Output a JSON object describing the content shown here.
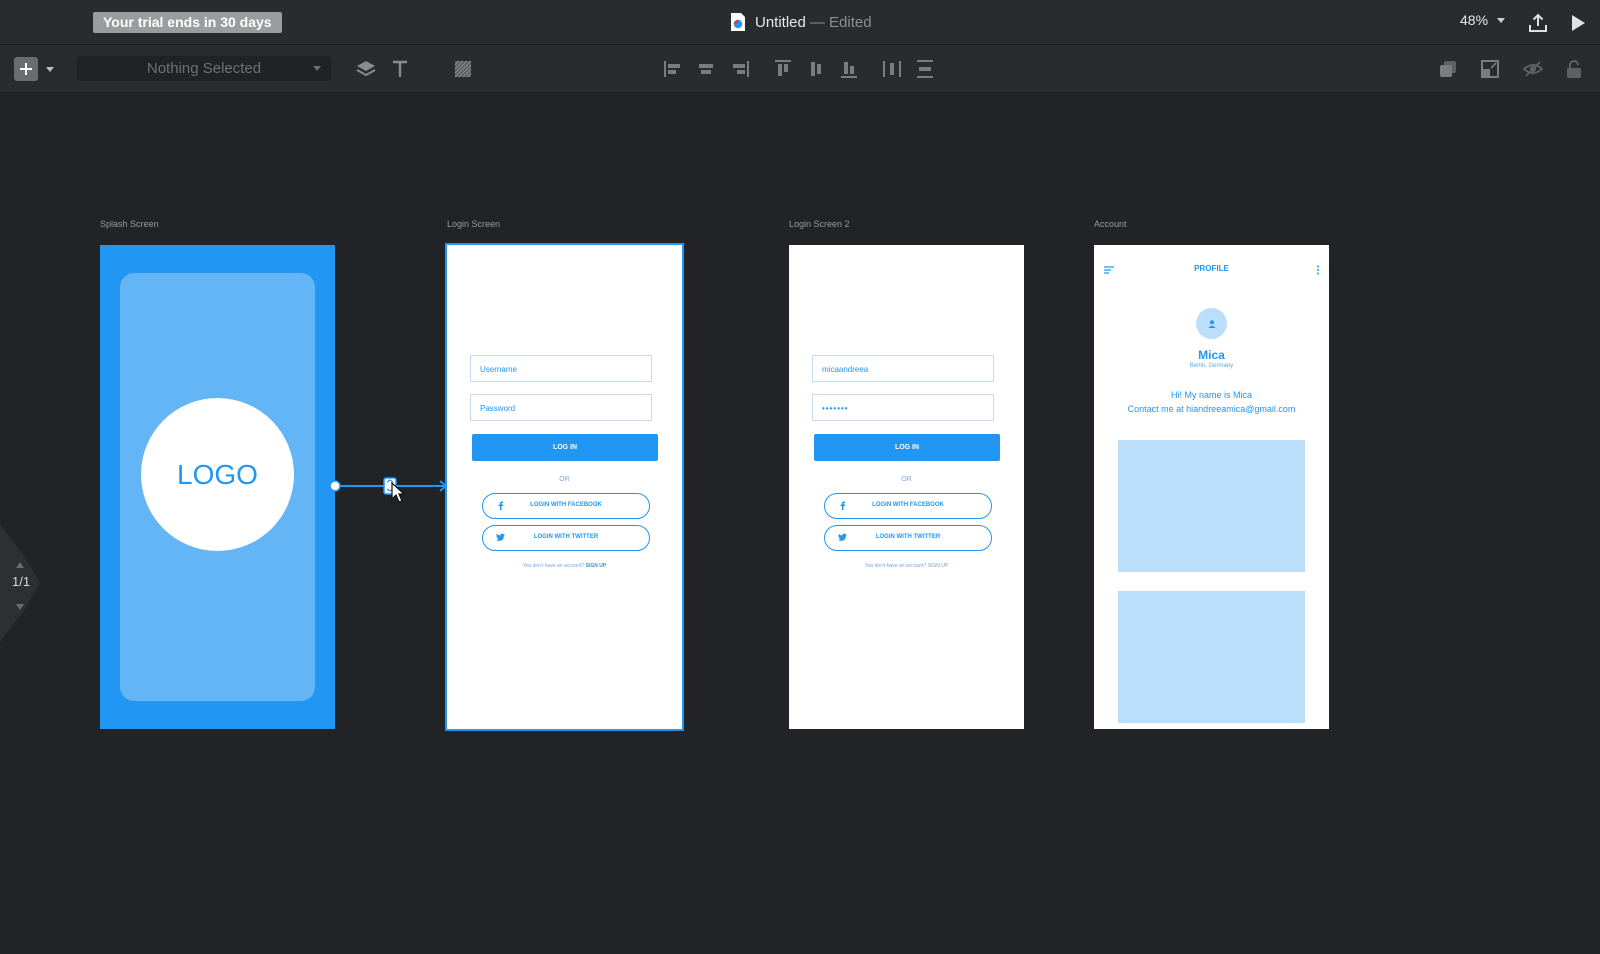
{
  "titlebar": {
    "trial_badge": "Your trial ends in 30 days",
    "doc_name": "Untitled",
    "doc_status": "— Edited",
    "zoom": "48%",
    "icons": [
      "document-icon",
      "share-icon",
      "play-icon"
    ]
  },
  "toolbar": {
    "selection": "Nothing Selected",
    "icons": [
      "add-icon",
      "layers-icon",
      "text-icon",
      "pattern-icon",
      "align-left-icon",
      "align-center-icon",
      "align-right-icon",
      "align-top-icon",
      "align-middle-icon",
      "align-bottom-icon",
      "distribute-horizontal-icon",
      "distribute-vertical-icon",
      "mask-icon",
      "resize-icon",
      "hide-icon",
      "lock-icon"
    ]
  },
  "pager": {
    "label": "1/1"
  },
  "artboards": {
    "splash": {
      "label": "Splash Screen",
      "logo": "LOGO"
    },
    "login": {
      "label": "Login Screen",
      "username_placeholder": "Username",
      "password_placeholder": "Password",
      "login_button": "LOG IN",
      "or": "OR",
      "facebook": "LOGIN WITH FACEBOOK",
      "twitter": "LOGIN WITH TWITTER",
      "signup_prompt": "You don't have an account?",
      "signup_link": "SIGN UP"
    },
    "login2": {
      "label": "Login Screen 2",
      "username_value": "micaandreea",
      "password_value": "•••••••",
      "login_button": "LOG IN",
      "or": "OR",
      "facebook": "LOGIN WITH FACEBOOK",
      "twitter": "LOGIN WITH TWITTER",
      "signup_prompt": "You don't have an account?",
      "signup_link": "SIGN UP"
    },
    "account": {
      "label": "Account",
      "header": "PROFILE",
      "name": "Mica",
      "location": "Berlin, Germany",
      "bio_line1": "Hi! My name is Mica",
      "bio_line2": "Contact me at hiandreeamica@gmail.com"
    }
  },
  "colors": {
    "accent": "#2196f3",
    "accent_light": "#64b5f6",
    "placeholder_block": "#bbdefb",
    "canvas": "#222326",
    "chrome": "#2a2b2e"
  }
}
